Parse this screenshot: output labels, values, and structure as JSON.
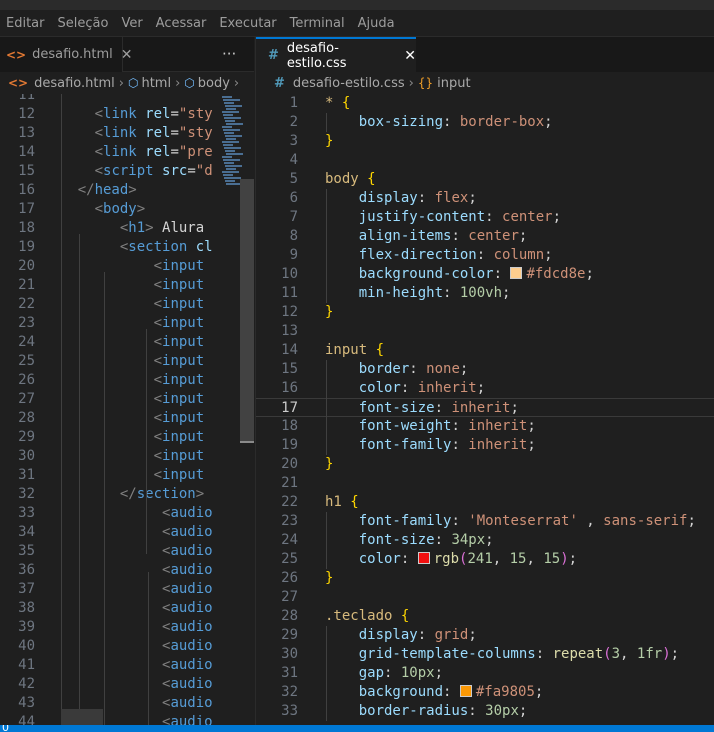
{
  "menu": [
    "Editar",
    "Seleção",
    "Ver",
    "Acessar",
    "Executar",
    "Terminal",
    "Ajuda"
  ],
  "left_editor": {
    "tab_label": "desafio.html",
    "more_label": "···",
    "breadcrumb": [
      "desafio.html",
      "html",
      "body"
    ],
    "lines": [
      {
        "n": "11",
        "indent": 0,
        "segs": []
      },
      {
        "n": "12",
        "indent": 6,
        "segs": [
          [
            "t-punc",
            "<"
          ],
          [
            "t-tag",
            "link"
          ],
          [
            "t-txt",
            " "
          ],
          [
            "t-attr",
            "rel"
          ],
          [
            "t-txt",
            "="
          ],
          [
            "t-str",
            "\"sty"
          ]
        ]
      },
      {
        "n": "13",
        "indent": 6,
        "segs": [
          [
            "t-punc",
            "<"
          ],
          [
            "t-tag",
            "link"
          ],
          [
            "t-txt",
            " "
          ],
          [
            "t-attr",
            "rel"
          ],
          [
            "t-txt",
            "="
          ],
          [
            "t-str",
            "\"sty"
          ]
        ]
      },
      {
        "n": "14",
        "indent": 6,
        "segs": [
          [
            "t-punc",
            "<"
          ],
          [
            "t-tag",
            "link"
          ],
          [
            "t-txt",
            " "
          ],
          [
            "t-attr",
            "rel"
          ],
          [
            "t-txt",
            "="
          ],
          [
            "t-str",
            "\"pre"
          ]
        ]
      },
      {
        "n": "15",
        "indent": 6,
        "segs": [
          [
            "t-punc",
            "<"
          ],
          [
            "t-tag",
            "script"
          ],
          [
            "t-txt",
            " "
          ],
          [
            "t-attr",
            "src"
          ],
          [
            "t-txt",
            "="
          ],
          [
            "t-str",
            "\"d"
          ]
        ]
      },
      {
        "n": "16",
        "indent": 4,
        "segs": [
          [
            "t-punc",
            "</"
          ],
          [
            "t-tag",
            "head"
          ],
          [
            "t-punc",
            ">"
          ]
        ]
      },
      {
        "n": "17",
        "indent": 6,
        "segs": [
          [
            "t-punc",
            "<"
          ],
          [
            "t-tag",
            "body"
          ],
          [
            "t-punc",
            ">"
          ]
        ]
      },
      {
        "n": "18",
        "indent": 9,
        "segs": [
          [
            "t-punc",
            "<"
          ],
          [
            "t-tag",
            "h1"
          ],
          [
            "t-punc",
            ">"
          ],
          [
            "t-txt",
            " Alura"
          ]
        ]
      },
      {
        "n": "19",
        "indent": 9,
        "segs": [
          [
            "t-punc",
            "<"
          ],
          [
            "t-tag",
            "section"
          ],
          [
            "t-txt",
            " "
          ],
          [
            "t-attr",
            "cl"
          ]
        ]
      },
      {
        "n": "20",
        "indent": 13,
        "segs": [
          [
            "t-punc",
            "<"
          ],
          [
            "t-tag",
            "input"
          ]
        ]
      },
      {
        "n": "21",
        "indent": 13,
        "segs": [
          [
            "t-punc",
            "<"
          ],
          [
            "t-tag",
            "input"
          ]
        ]
      },
      {
        "n": "22",
        "indent": 13,
        "segs": [
          [
            "t-punc",
            "<"
          ],
          [
            "t-tag",
            "input"
          ]
        ]
      },
      {
        "n": "23",
        "indent": 13,
        "segs": [
          [
            "t-punc",
            "<"
          ],
          [
            "t-tag",
            "input"
          ]
        ]
      },
      {
        "n": "24",
        "indent": 13,
        "segs": [
          [
            "t-punc",
            "<"
          ],
          [
            "t-tag",
            "input"
          ]
        ]
      },
      {
        "n": "25",
        "indent": 13,
        "segs": [
          [
            "t-punc",
            "<"
          ],
          [
            "t-tag",
            "input"
          ]
        ]
      },
      {
        "n": "26",
        "indent": 13,
        "segs": [
          [
            "t-punc",
            "<"
          ],
          [
            "t-tag",
            "input"
          ]
        ]
      },
      {
        "n": "27",
        "indent": 13,
        "segs": [
          [
            "t-punc",
            "<"
          ],
          [
            "t-tag",
            "input"
          ]
        ]
      },
      {
        "n": "28",
        "indent": 13,
        "segs": [
          [
            "t-punc",
            "<"
          ],
          [
            "t-tag",
            "input"
          ]
        ]
      },
      {
        "n": "29",
        "indent": 13,
        "segs": [
          [
            "t-punc",
            "<"
          ],
          [
            "t-tag",
            "input"
          ]
        ]
      },
      {
        "n": "30",
        "indent": 13,
        "segs": [
          [
            "t-punc",
            "<"
          ],
          [
            "t-tag",
            "input"
          ]
        ]
      },
      {
        "n": "31",
        "indent": 13,
        "segs": [
          [
            "t-punc",
            "<"
          ],
          [
            "t-tag",
            "input"
          ]
        ]
      },
      {
        "n": "32",
        "indent": 9,
        "segs": [
          [
            "t-punc",
            "</"
          ],
          [
            "t-tag",
            "section"
          ],
          [
            "t-punc",
            ">"
          ]
        ]
      },
      {
        "n": "33",
        "indent": 14,
        "segs": [
          [
            "t-punc",
            "<"
          ],
          [
            "t-tag",
            "audio"
          ]
        ]
      },
      {
        "n": "34",
        "indent": 14,
        "segs": [
          [
            "t-punc",
            "<"
          ],
          [
            "t-tag",
            "audio"
          ]
        ]
      },
      {
        "n": "35",
        "indent": 14,
        "segs": [
          [
            "t-punc",
            "<"
          ],
          [
            "t-tag",
            "audio"
          ]
        ]
      },
      {
        "n": "36",
        "indent": 14,
        "segs": [
          [
            "t-punc",
            "<"
          ],
          [
            "t-tag",
            "audio"
          ]
        ]
      },
      {
        "n": "37",
        "indent": 14,
        "segs": [
          [
            "t-punc",
            "<"
          ],
          [
            "t-tag",
            "audio"
          ]
        ]
      },
      {
        "n": "38",
        "indent": 14,
        "segs": [
          [
            "t-punc",
            "<"
          ],
          [
            "t-tag",
            "audio"
          ]
        ]
      },
      {
        "n": "39",
        "indent": 14,
        "segs": [
          [
            "t-punc",
            "<"
          ],
          [
            "t-tag",
            "audio"
          ]
        ]
      },
      {
        "n": "40",
        "indent": 14,
        "segs": [
          [
            "t-punc",
            "<"
          ],
          [
            "t-tag",
            "audio"
          ]
        ]
      },
      {
        "n": "41",
        "indent": 14,
        "segs": [
          [
            "t-punc",
            "<"
          ],
          [
            "t-tag",
            "audio"
          ]
        ]
      },
      {
        "n": "42",
        "indent": 14,
        "segs": [
          [
            "t-punc",
            "<"
          ],
          [
            "t-tag",
            "audio"
          ]
        ]
      },
      {
        "n": "43",
        "indent": 14,
        "segs": [
          [
            "t-punc",
            "<"
          ],
          [
            "t-tag",
            "audio"
          ]
        ]
      },
      {
        "n": "44",
        "indent": 14,
        "segs": [
          [
            "t-punc",
            "<"
          ],
          [
            "t-tag",
            "audio"
          ]
        ]
      }
    ]
  },
  "right_editor": {
    "tab_label": "desafio-estilo.css",
    "breadcrumb": [
      "desafio-estilo.css",
      "input"
    ],
    "current_line": "17",
    "lines": [
      {
        "n": "1",
        "indent": 0,
        "segs": [
          [
            "t-sel",
            "*"
          ],
          [
            "t-plain",
            " "
          ],
          [
            "t-brace",
            "{"
          ]
        ]
      },
      {
        "n": "2",
        "indent": 4,
        "segs": [
          [
            "t-prop",
            "box-sizing"
          ],
          [
            "t-plain",
            ": "
          ],
          [
            "t-val",
            "border-box"
          ],
          [
            "t-plain",
            ";"
          ]
        ]
      },
      {
        "n": "3",
        "indent": 0,
        "segs": [
          [
            "t-brace",
            "}"
          ]
        ]
      },
      {
        "n": "4",
        "indent": 0,
        "segs": []
      },
      {
        "n": "5",
        "indent": 0,
        "segs": [
          [
            "t-sel",
            "body"
          ],
          [
            "t-plain",
            " "
          ],
          [
            "t-brace",
            "{"
          ]
        ]
      },
      {
        "n": "6",
        "indent": 4,
        "segs": [
          [
            "t-prop",
            "display"
          ],
          [
            "t-plain",
            ": "
          ],
          [
            "t-val",
            "flex"
          ],
          [
            "t-plain",
            ";"
          ]
        ]
      },
      {
        "n": "7",
        "indent": 4,
        "segs": [
          [
            "t-prop",
            "justify-content"
          ],
          [
            "t-plain",
            ": "
          ],
          [
            "t-val",
            "center"
          ],
          [
            "t-plain",
            ";"
          ]
        ]
      },
      {
        "n": "8",
        "indent": 4,
        "segs": [
          [
            "t-prop",
            "align-items"
          ],
          [
            "t-plain",
            ": "
          ],
          [
            "t-val",
            "center"
          ],
          [
            "t-plain",
            ";"
          ]
        ]
      },
      {
        "n": "9",
        "indent": 4,
        "segs": [
          [
            "t-prop",
            "flex-direction"
          ],
          [
            "t-plain",
            ": "
          ],
          [
            "t-val",
            "column"
          ],
          [
            "t-plain",
            ";"
          ]
        ]
      },
      {
        "n": "10",
        "indent": 4,
        "segs": [
          [
            "t-prop",
            "background-color"
          ],
          [
            "t-plain",
            ": "
          ],
          [
            "swatch",
            "#fdcd8e"
          ],
          [
            "t-val",
            "#fdcd8e"
          ],
          [
            "t-plain",
            ";"
          ]
        ]
      },
      {
        "n": "11",
        "indent": 4,
        "segs": [
          [
            "t-prop",
            "min-height"
          ],
          [
            "t-plain",
            ": "
          ],
          [
            "t-num",
            "100vh"
          ],
          [
            "t-plain",
            ";"
          ]
        ]
      },
      {
        "n": "12",
        "indent": 0,
        "segs": [
          [
            "t-brace",
            "}"
          ]
        ]
      },
      {
        "n": "13",
        "indent": 0,
        "segs": []
      },
      {
        "n": "14",
        "indent": 0,
        "segs": [
          [
            "t-sel",
            "input"
          ],
          [
            "t-plain",
            " "
          ],
          [
            "t-brace",
            "{"
          ]
        ]
      },
      {
        "n": "15",
        "indent": 4,
        "segs": [
          [
            "t-prop",
            "border"
          ],
          [
            "t-plain",
            ": "
          ],
          [
            "t-val",
            "none"
          ],
          [
            "t-plain",
            ";"
          ]
        ]
      },
      {
        "n": "16",
        "indent": 4,
        "segs": [
          [
            "t-prop",
            "color"
          ],
          [
            "t-plain",
            ": "
          ],
          [
            "t-val",
            "inherit"
          ],
          [
            "t-plain",
            ";"
          ]
        ]
      },
      {
        "n": "17",
        "indent": 4,
        "segs": [
          [
            "t-prop",
            "font-size"
          ],
          [
            "t-plain",
            ": "
          ],
          [
            "t-val",
            "inherit"
          ],
          [
            "t-plain",
            ";"
          ]
        ]
      },
      {
        "n": "18",
        "indent": 4,
        "segs": [
          [
            "t-prop",
            "font-weight"
          ],
          [
            "t-plain",
            ": "
          ],
          [
            "t-val",
            "inherit"
          ],
          [
            "t-plain",
            ";"
          ]
        ]
      },
      {
        "n": "19",
        "indent": 4,
        "segs": [
          [
            "t-prop",
            "font-family"
          ],
          [
            "t-plain",
            ": "
          ],
          [
            "t-val",
            "inherit"
          ],
          [
            "t-plain",
            ";"
          ]
        ]
      },
      {
        "n": "20",
        "indent": 0,
        "segs": [
          [
            "t-brace",
            "}"
          ]
        ]
      },
      {
        "n": "21",
        "indent": 0,
        "segs": []
      },
      {
        "n": "22",
        "indent": 0,
        "segs": [
          [
            "t-sel",
            "h1"
          ],
          [
            "t-plain",
            " "
          ],
          [
            "t-brace",
            "{"
          ]
        ]
      },
      {
        "n": "23",
        "indent": 4,
        "segs": [
          [
            "t-prop",
            "font-family"
          ],
          [
            "t-plain",
            ": "
          ],
          [
            "t-val",
            "'Monteserrat'"
          ],
          [
            "t-plain",
            " , "
          ],
          [
            "t-val",
            "sans-serif"
          ],
          [
            "t-plain",
            ";"
          ]
        ]
      },
      {
        "n": "24",
        "indent": 4,
        "segs": [
          [
            "t-prop",
            "font-size"
          ],
          [
            "t-plain",
            ": "
          ],
          [
            "t-num",
            "34px"
          ],
          [
            "t-plain",
            ";"
          ]
        ]
      },
      {
        "n": "25",
        "indent": 4,
        "segs": [
          [
            "t-prop",
            "color"
          ],
          [
            "t-plain",
            ": "
          ],
          [
            "swatch",
            "#f10f0f"
          ],
          [
            "t-fn",
            "rgb"
          ],
          [
            "t-paren",
            "("
          ],
          [
            "t-num",
            "241"
          ],
          [
            "t-plain",
            ", "
          ],
          [
            "t-num",
            "15"
          ],
          [
            "t-plain",
            ", "
          ],
          [
            "t-num",
            "15"
          ],
          [
            "t-paren",
            ")"
          ],
          [
            "t-plain",
            ";"
          ]
        ]
      },
      {
        "n": "26",
        "indent": 0,
        "segs": [
          [
            "t-brace",
            "}"
          ]
        ]
      },
      {
        "n": "27",
        "indent": 0,
        "segs": []
      },
      {
        "n": "28",
        "indent": 0,
        "segs": [
          [
            "t-sel",
            ".teclado"
          ],
          [
            "t-plain",
            " "
          ],
          [
            "t-brace",
            "{"
          ]
        ]
      },
      {
        "n": "29",
        "indent": 4,
        "segs": [
          [
            "t-prop",
            "display"
          ],
          [
            "t-plain",
            ": "
          ],
          [
            "t-val",
            "grid"
          ],
          [
            "t-plain",
            ";"
          ]
        ]
      },
      {
        "n": "30",
        "indent": 4,
        "segs": [
          [
            "t-prop",
            "grid-template-columns"
          ],
          [
            "t-plain",
            ": "
          ],
          [
            "t-fn",
            "repeat"
          ],
          [
            "t-paren",
            "("
          ],
          [
            "t-num",
            "3"
          ],
          [
            "t-plain",
            ", "
          ],
          [
            "t-num",
            "1fr"
          ],
          [
            "t-paren",
            ")"
          ],
          [
            "t-plain",
            ";"
          ]
        ]
      },
      {
        "n": "31",
        "indent": 4,
        "segs": [
          [
            "t-prop",
            "gap"
          ],
          [
            "t-plain",
            ": "
          ],
          [
            "t-num",
            "10px"
          ],
          [
            "t-plain",
            ";"
          ]
        ]
      },
      {
        "n": "32",
        "indent": 4,
        "segs": [
          [
            "t-prop",
            "background"
          ],
          [
            "t-plain",
            ": "
          ],
          [
            "swatch",
            "#fa9805"
          ],
          [
            "t-val",
            "#fa9805"
          ],
          [
            "t-plain",
            ";"
          ]
        ]
      },
      {
        "n": "33",
        "indent": 4,
        "segs": [
          [
            "t-prop",
            "border-radius"
          ],
          [
            "t-plain",
            ": "
          ],
          [
            "t-num",
            "30px"
          ],
          [
            "t-plain",
            ";"
          ]
        ]
      }
    ]
  },
  "status": {
    "text": "0"
  }
}
